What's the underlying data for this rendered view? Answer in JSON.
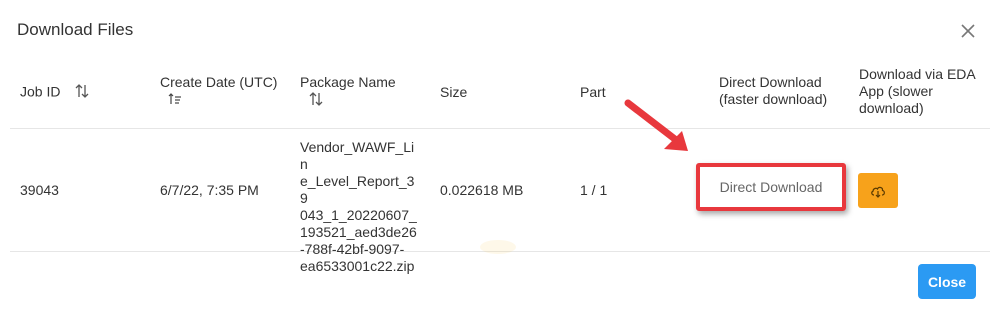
{
  "dialog": {
    "title": "Download Files",
    "close_icon": "close-icon",
    "close_button_label": "Close"
  },
  "table": {
    "headers": {
      "job_id": "Job ID",
      "create_date": "Create Date (UTC)",
      "package_name": "Package Name",
      "size": "Size",
      "part": "Part",
      "direct_download_line1": "Direct Download",
      "direct_download_line2": "(faster download)",
      "eda_line1": "Download via EDA",
      "eda_line2": "App (slower",
      "eda_line3": "download)"
    },
    "rows": [
      {
        "job_id": "39043",
        "create_date": "6/7/22, 7:35 PM",
        "package_lines": [
          "Vendor_WAWF_Lin",
          "e_Level_Report_39",
          "043_1_20220607_",
          "193521_aed3de26",
          "-788f-42bf-9097-",
          "ea6533001c22.zip"
        ],
        "size": "0.022618 MB",
        "part": "1 / 1",
        "direct_download_label": "Direct Download",
        "eda_icon": "cloud-download-icon"
      }
    ]
  },
  "colors": {
    "accent_blue": "#2b9af3",
    "eda_orange": "#f7a21b",
    "highlight_red": "#e8383d"
  }
}
